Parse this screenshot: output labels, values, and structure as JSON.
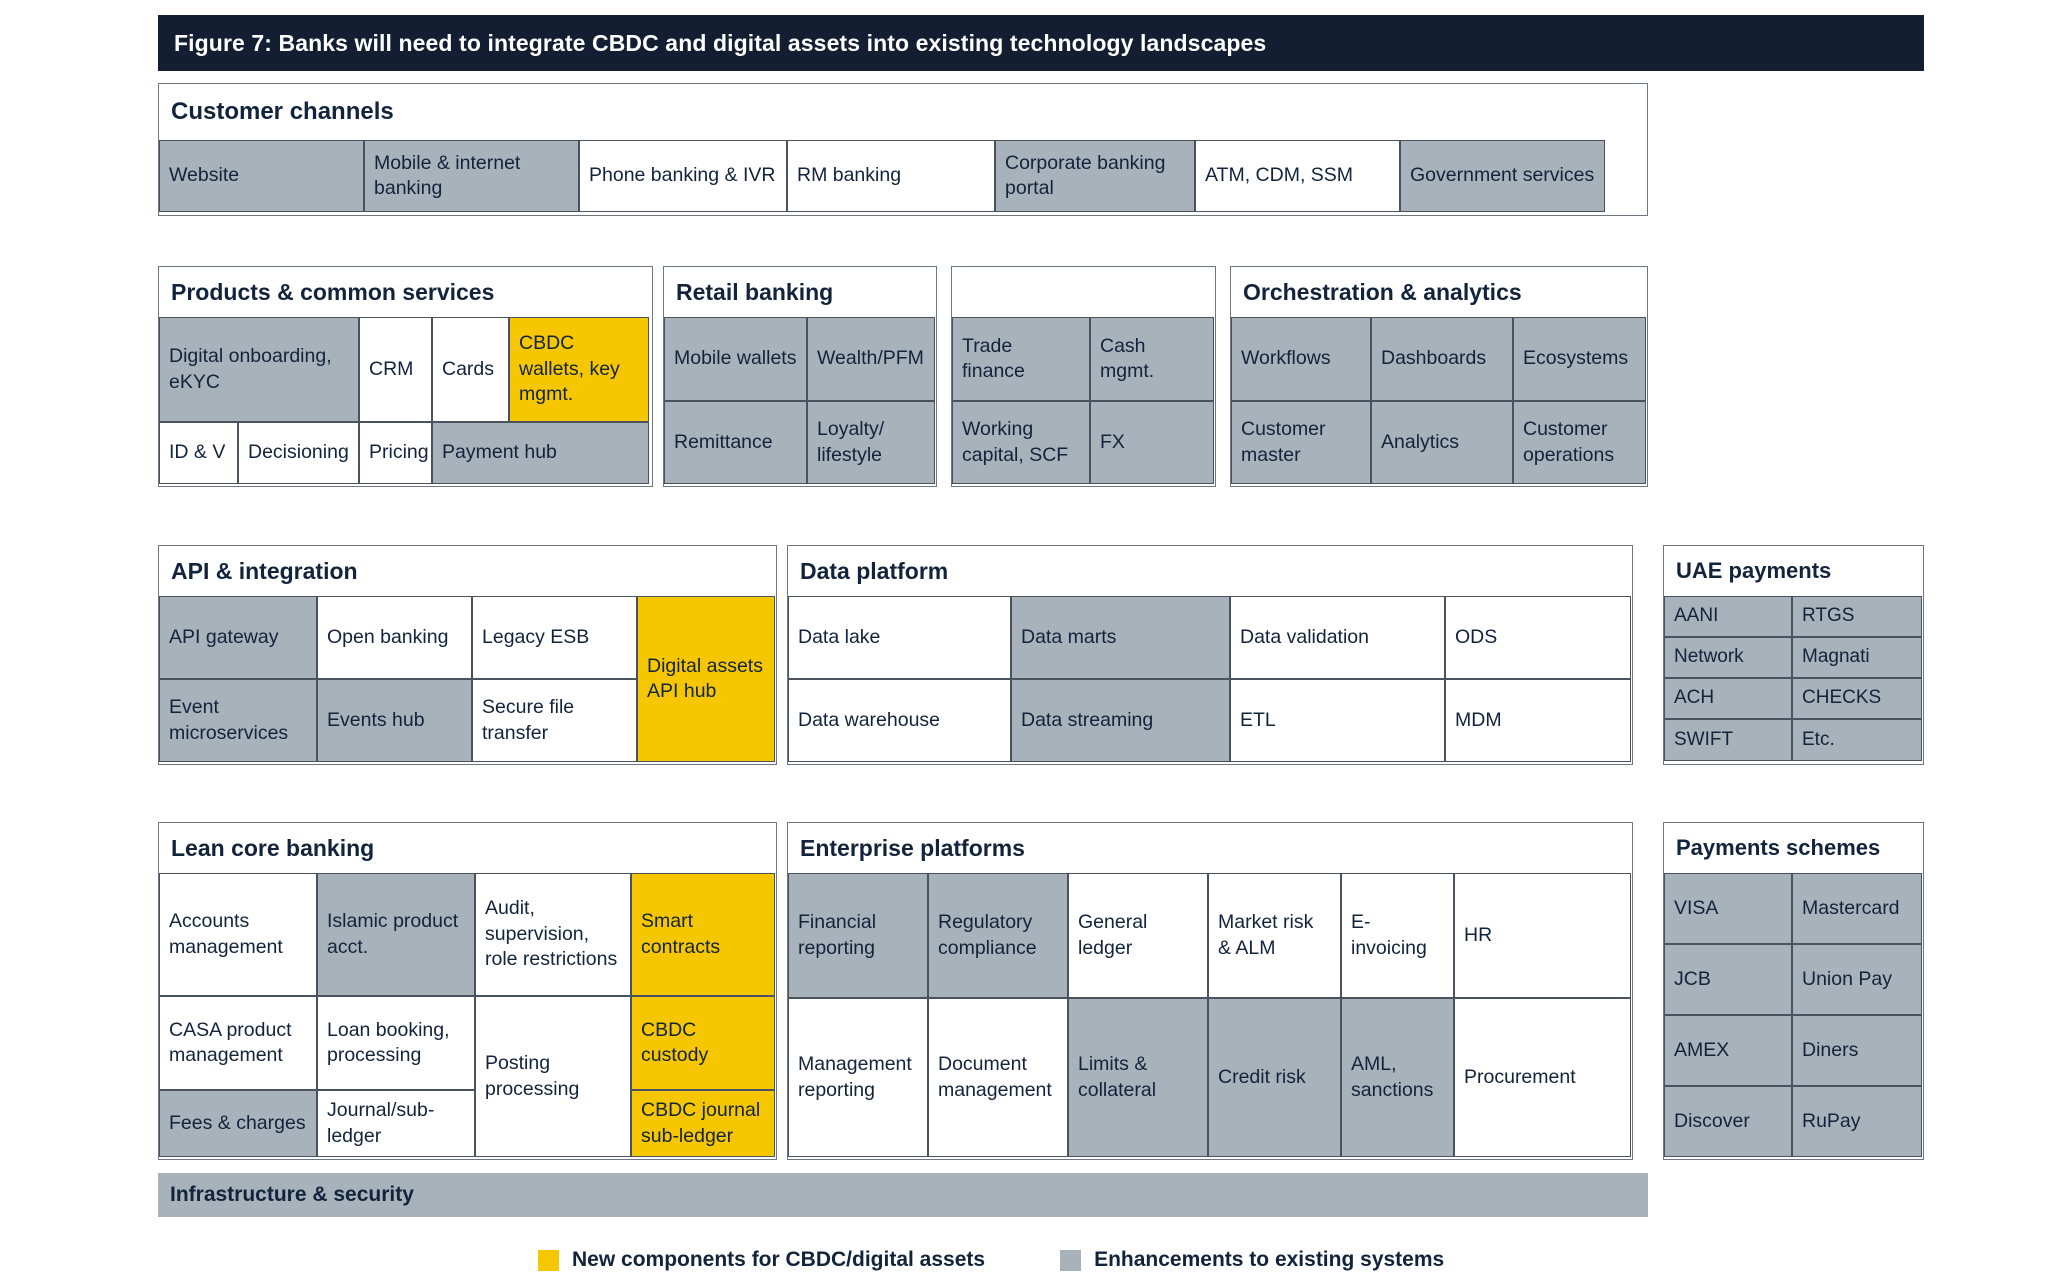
{
  "figure": {
    "title": "Figure 7: Banks will need to integrate CBDC and digital assets into existing technology landscapes"
  },
  "colors": {
    "title_bar": "#141e32",
    "new_component": "#f6c700",
    "enhancement": "#a8b2bb",
    "border": "#49525e",
    "text": "#12233c"
  },
  "customer_channels": {
    "header": "Customer channels",
    "cells": [
      {
        "label": "Website",
        "style": "grey"
      },
      {
        "label": "Mobile & internet banking",
        "style": "grey"
      },
      {
        "label": "Phone banking & IVR",
        "style": "white"
      },
      {
        "label": "RM banking",
        "style": "white"
      },
      {
        "label": "Corporate banking portal",
        "style": "grey"
      },
      {
        "label": "ATM, CDM, SSM",
        "style": "white"
      },
      {
        "label": "Government services",
        "style": "grey"
      }
    ]
  },
  "products": {
    "header": "Products & common services",
    "row1": [
      {
        "label": "Digital onboarding, eKYC",
        "style": "grey"
      },
      {
        "label": "CRM",
        "style": "white"
      },
      {
        "label": "Cards",
        "style": "white"
      },
      {
        "label": "CBDC wallets, key mgmt.",
        "style": "yellow"
      }
    ],
    "row2": [
      {
        "label": "ID & V",
        "style": "white"
      },
      {
        "label": "Decisioning",
        "style": "white"
      },
      {
        "label": "Pricing",
        "style": "white"
      },
      {
        "label": "Payment hub",
        "style": "grey"
      }
    ]
  },
  "retail": {
    "header": "Retail banking",
    "cells": [
      {
        "label": "Mobile wallets",
        "style": "grey"
      },
      {
        "label": "Wealth/PFM",
        "style": "grey"
      },
      {
        "label": "Remittance",
        "style": "grey"
      },
      {
        "label": "Loyalty/ lifestyle",
        "style": "grey"
      }
    ]
  },
  "wholesale": {
    "header": "",
    "cells": [
      {
        "label": "Trade finance",
        "style": "grey"
      },
      {
        "label": "Cash mgmt.",
        "style": "grey"
      },
      {
        "label": "Working capital, SCF",
        "style": "grey"
      },
      {
        "label": "FX",
        "style": "grey"
      }
    ]
  },
  "orchestration": {
    "header": "Orchestration & analytics",
    "cells": [
      {
        "label": "Workflows",
        "style": "grey"
      },
      {
        "label": "Dashboards",
        "style": "grey"
      },
      {
        "label": "Ecosystems",
        "style": "grey"
      },
      {
        "label": "Customer master",
        "style": "grey"
      },
      {
        "label": "Analytics",
        "style": "grey"
      },
      {
        "label": "Customer operations",
        "style": "grey"
      }
    ]
  },
  "api": {
    "header": "API & integration",
    "cells": [
      {
        "label": "API gateway",
        "style": "grey"
      },
      {
        "label": "Open banking",
        "style": "white"
      },
      {
        "label": "Legacy ESB",
        "style": "white"
      },
      {
        "label": "Event microservices",
        "style": "grey"
      },
      {
        "label": "Events hub",
        "style": "grey"
      },
      {
        "label": "Secure file transfer",
        "style": "white"
      }
    ],
    "tall_cell": {
      "label": "Digital assets API hub",
      "style": "yellow"
    }
  },
  "data_platform": {
    "header": "Data platform",
    "cells": [
      {
        "label": "Data lake",
        "style": "white"
      },
      {
        "label": "Data marts",
        "style": "grey"
      },
      {
        "label": "Data validation",
        "style": "white"
      },
      {
        "label": "ODS",
        "style": "white"
      },
      {
        "label": "Data warehouse",
        "style": "white"
      },
      {
        "label": "Data streaming",
        "style": "grey"
      },
      {
        "label": "ETL",
        "style": "white"
      },
      {
        "label": "MDM",
        "style": "white"
      }
    ]
  },
  "uae_payments": {
    "header": "UAE payments",
    "cells": [
      {
        "label": "AANI",
        "style": "grey"
      },
      {
        "label": "RTGS",
        "style": "grey"
      },
      {
        "label": "Network",
        "style": "grey"
      },
      {
        "label": "Magnati",
        "style": "grey"
      },
      {
        "label": "ACH",
        "style": "grey"
      },
      {
        "label": "CHECKS",
        "style": "grey"
      },
      {
        "label": "SWIFT",
        "style": "grey"
      },
      {
        "label": "Etc.",
        "style": "grey"
      }
    ]
  },
  "lean_core": {
    "header": "Lean core banking",
    "col1": [
      {
        "label": "Accounts management",
        "style": "white"
      },
      {
        "label": "CASA product management",
        "style": "white"
      },
      {
        "label": "Fees & charges",
        "style": "grey"
      }
    ],
    "col2": [
      {
        "label": "Islamic product acct.",
        "style": "grey"
      },
      {
        "label": "Loan booking, processing",
        "style": "white"
      },
      {
        "label": "Journal/sub-ledger",
        "style": "white"
      }
    ],
    "col3": [
      {
        "label": "Audit, supervision, role restrictions",
        "style": "white"
      },
      {
        "label": "Posting processing",
        "style": "white"
      }
    ],
    "col4": [
      {
        "label": "Smart contracts",
        "style": "yellow"
      },
      {
        "label": "CBDC custody",
        "style": "yellow"
      },
      {
        "label": "CBDC journal sub-ledger",
        "style": "yellow"
      }
    ]
  },
  "enterprise": {
    "header": "Enterprise platforms",
    "cells": [
      {
        "label": "Financial reporting",
        "style": "grey"
      },
      {
        "label": "Regulatory compliance",
        "style": "grey"
      },
      {
        "label": "General ledger",
        "style": "white"
      },
      {
        "label": "Market risk & ALM",
        "style": "white"
      },
      {
        "label": "E-invoicing",
        "style": "white"
      },
      {
        "label": "HR",
        "style": "white"
      },
      {
        "label": "Management reporting",
        "style": "white"
      },
      {
        "label": "Document management",
        "style": "white"
      },
      {
        "label": "Limits & collateral",
        "style": "grey"
      },
      {
        "label": "Credit risk",
        "style": "grey"
      },
      {
        "label": "AML, sanctions",
        "style": "grey"
      },
      {
        "label": "Procurement",
        "style": "white"
      }
    ]
  },
  "payment_schemes": {
    "header": "Payments schemes",
    "cells": [
      {
        "label": "VISA",
        "style": "grey"
      },
      {
        "label": "Mastercard",
        "style": "grey"
      },
      {
        "label": "JCB",
        "style": "grey"
      },
      {
        "label": "Union Pay",
        "style": "grey"
      },
      {
        "label": "AMEX",
        "style": "grey"
      },
      {
        "label": "Diners",
        "style": "grey"
      },
      {
        "label": "Discover",
        "style": "grey"
      },
      {
        "label": "RuPay",
        "style": "grey"
      }
    ]
  },
  "infrastructure": {
    "label": "Infrastructure & security"
  },
  "legend": {
    "new_label": "New components for CBDC/digital assets",
    "enhancement_label": "Enhancements to existing systems"
  }
}
